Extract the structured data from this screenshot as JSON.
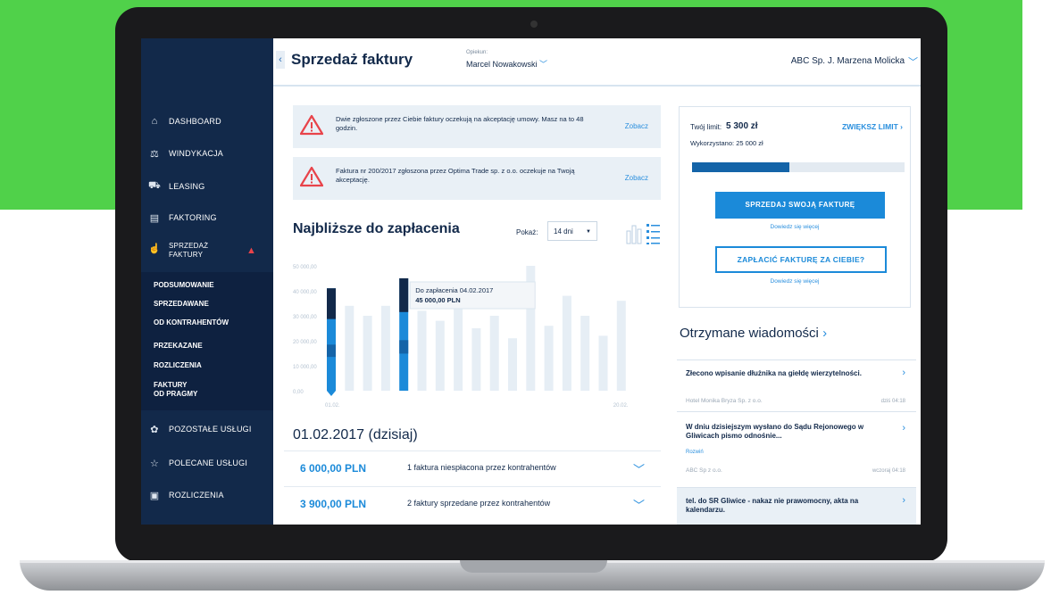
{
  "colors": {
    "background_green": "#50d14a",
    "sidebar": "#12294a",
    "accent": "#1b8ad9",
    "alert_red": "#e8434a"
  },
  "header": {
    "title": "Sprzedaż faktury",
    "back_icon": "chevron-left-icon",
    "opiekun_label": "Opiekun:",
    "opiekun_name": "Marcel Nowakowski",
    "company": "ABC Sp. J. Marzena Molicka"
  },
  "sidebar": {
    "items": [
      {
        "label": "DASHBOARD",
        "icon": "home-icon",
        "glyph": "⌂"
      },
      {
        "label": "WINDYKACJA",
        "icon": "collection-icon",
        "glyph": "⚖"
      },
      {
        "label": "LEASING",
        "icon": "car-icon",
        "glyph": "⛟"
      },
      {
        "label": "FAKTORING",
        "icon": "document-icon",
        "glyph": "▤"
      },
      {
        "label": "SPRZEDAŻ",
        "label2": "FAKTURY",
        "icon": "thumb-icon",
        "glyph": "☝"
      }
    ],
    "subitems": [
      "PODSUMOWANIE",
      "SPRZEDAWANE",
      "OD KONTRAHENTÓW",
      "PRZEKAZANE",
      "ROZLICZENIA",
      "FAKTURY",
      "OD PRAGMY"
    ],
    "bottom_items": [
      {
        "label": "POZOSTAŁE USŁUGI",
        "icon": "services-icon",
        "glyph": "✿"
      },
      {
        "label": "POLECANE USŁUGI",
        "icon": "star-icon",
        "glyph": "☆"
      },
      {
        "label": "ROZLICZENIA",
        "icon": "wallet-icon",
        "glyph": "▣"
      }
    ]
  },
  "alerts": [
    {
      "text": "Dwie zgłoszone przez Ciebie faktury oczekują na akceptację umowy. Masz na to 48 godzin.",
      "link": "Zobacz"
    },
    {
      "text": "Faktura nr 200/2017 zgłoszona przez Optima Trade sp. z o.o. oczekuje na Twoją akceptację.",
      "link": "Zobacz"
    }
  ],
  "limit": {
    "label": "Twój limit:",
    "value": "5 300 zł",
    "increase": "ZWIĘKSZ LIMIT",
    "used": "Wykorzystano: 25 000 zł",
    "progress_fraction": 0.46,
    "sell_button": "SPRZEDAJ SWOJĄ FAKTURĘ",
    "learn_more": "Dowiedz się więcej",
    "pay_button": "ZAPŁACIĆ FAKTURĘ ZA CIEBIE?"
  },
  "chart": {
    "title": "Najbliższe do zapłacenia",
    "show_label": "Pokaż:",
    "period": "14 dni",
    "tooltip_line1": "Do zapłacenia 04.02.2017",
    "tooltip_line2": "45 000,00 PLN"
  },
  "chart_data": {
    "type": "bar",
    "title": "Najbliższe do zapłacenia",
    "y_ticks": [
      "50 000,00",
      "40 000,00",
      "30 000,00",
      "20 000,00",
      "10 000,00",
      "0,00"
    ],
    "x_tick_first": "01.02.",
    "x_tick_last": "20.02.",
    "ylim": [
      0,
      50000
    ],
    "values": [
      41000,
      34000,
      30000,
      34000,
      45000,
      32000,
      28000,
      38000,
      25000,
      30000,
      21000,
      50000,
      26000,
      38000,
      30000,
      22000,
      36000
    ],
    "highlighted_indices": [
      0,
      4
    ]
  },
  "day": {
    "header": "01.02.2017 (dzisiaj)",
    "rows": [
      {
        "amount": "6 000,00 PLN",
        "desc": "1 faktura niespłacona przez kontrahentów"
      },
      {
        "amount": "3 900,00 PLN",
        "desc": "2 faktury sprzedane przez kontrahentów"
      }
    ]
  },
  "messages": {
    "title": "Otrzymane wiadomości",
    "items": [
      {
        "text": "Złecono wpisanie dłużnika na giełdę wierzytelności.",
        "sender": "Hotel Monika Bryza Sp. z o.o.",
        "date": "dziś 04:18"
      },
      {
        "text": "W dniu dzisiejszym wysłano do Sądu Rejonowego w Gliwicach pismo odnośnie...",
        "rozwin": "Rozwiń",
        "sender": "ABC Sp z o.o.",
        "date": "wczoraj 04:18"
      },
      {
        "text": "tel. do SR Gliwice - nakaz nie prawomocny, akta na kalendarzu."
      }
    ]
  }
}
